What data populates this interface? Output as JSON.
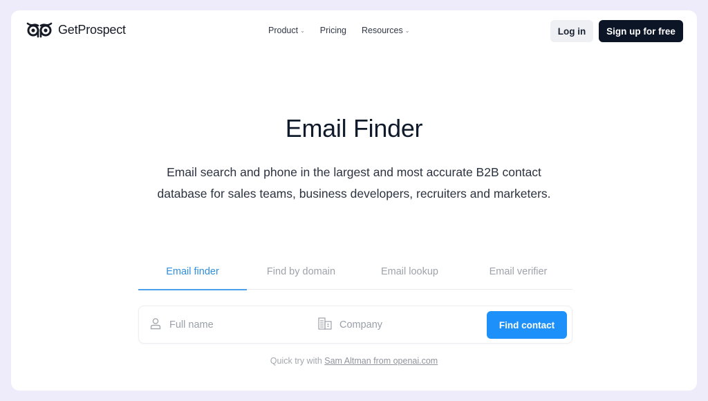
{
  "brand": {
    "name": "GetProspect",
    "logo_icon": "owl-eyes-icon"
  },
  "nav": {
    "items": [
      {
        "label": "Product",
        "has_dropdown": true
      },
      {
        "label": "Pricing",
        "has_dropdown": false
      },
      {
        "label": "Resources",
        "has_dropdown": true
      }
    ],
    "dropdown_icon": "chevron-down-icon"
  },
  "header_actions": {
    "login_label": "Log in",
    "signup_label": "Sign up for free"
  },
  "hero": {
    "title": "Email Finder",
    "subtitle": "Email search and phone in the largest and most accurate B2B contact database for sales teams, business developers, recruiters and marketers."
  },
  "tabs": [
    {
      "label": "Email finder",
      "active": true
    },
    {
      "label": "Find by domain",
      "active": false
    },
    {
      "label": "Email lookup",
      "active": false
    },
    {
      "label": "Email verifier",
      "active": false
    }
  ],
  "search": {
    "full_name": {
      "placeholder": "Full name",
      "value": "",
      "icon": "user-icon"
    },
    "company": {
      "placeholder": "Company",
      "value": "",
      "icon": "building-icon"
    },
    "submit_label": "Find contact"
  },
  "quick_try": {
    "prefix": "Quick try with",
    "link_label": "Sam Altman from openai.com"
  },
  "colors": {
    "accent": "#1e90fa",
    "active_tab": "#2d8fe0",
    "primary_dark": "#0b1526",
    "page_background": "#eeecfb"
  }
}
